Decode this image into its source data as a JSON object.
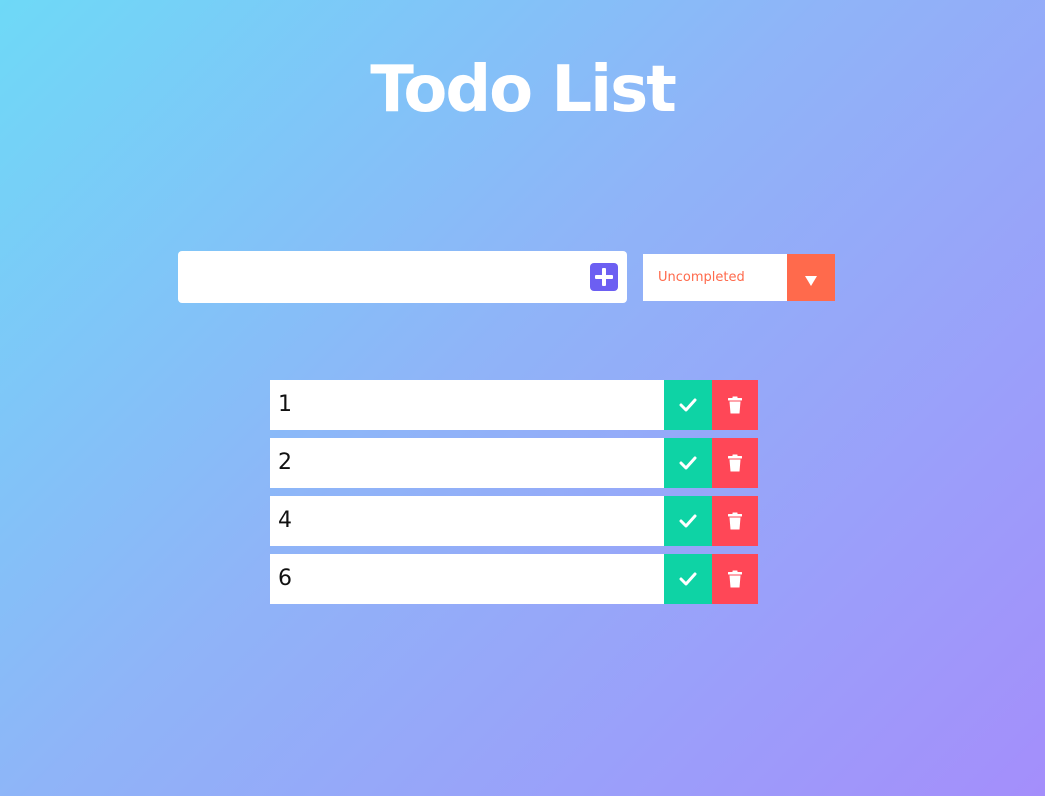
{
  "header": {
    "title": "Todo List"
  },
  "form": {
    "input_value": "",
    "input_placeholder": "",
    "add_icon": "plus-square-icon",
    "filter_selected": "Uncompleted",
    "filter_icon": "triangle-down-icon"
  },
  "todos": [
    {
      "text": "1"
    },
    {
      "text": "2"
    },
    {
      "text": "4"
    },
    {
      "text": "6"
    }
  ],
  "colors": {
    "gradient_start": "#6ed9f7",
    "gradient_end": "#a48efb",
    "add_button": "#6c5ff2",
    "filter_accent": "#ff6a4c",
    "complete_button": "#0ed3a5",
    "delete_button": "#ff4757"
  },
  "icons": {
    "complete": "check-icon",
    "delete": "trash-icon"
  }
}
